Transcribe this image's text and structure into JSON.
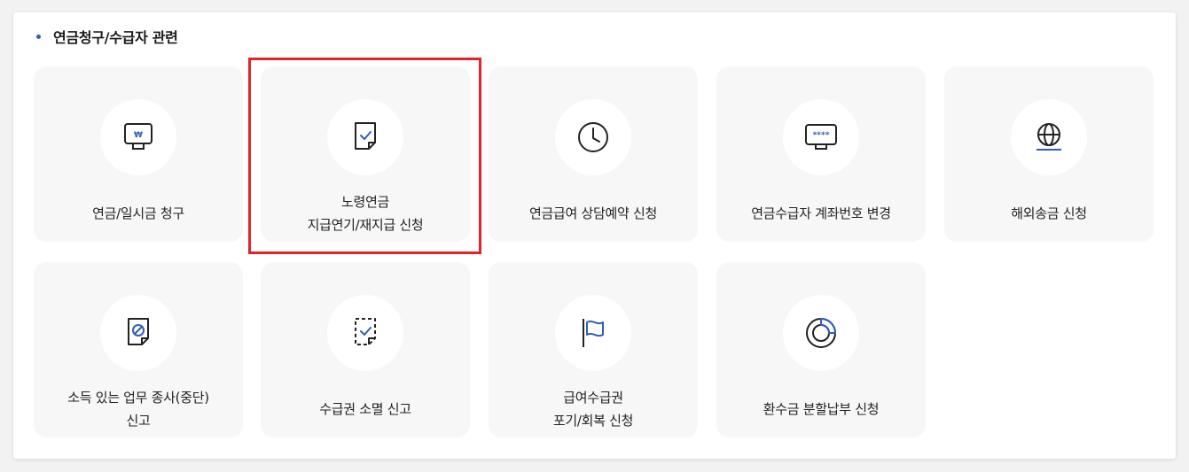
{
  "section": {
    "title": "연금청구/수급자 관련"
  },
  "colors": {
    "accent": "#2f5fb3",
    "highlight": "#e2232b",
    "card_bg": "#f7f7f7"
  },
  "cards": [
    {
      "icon": "monitor-won-icon",
      "lines": [
        "연금/일시금 청구"
      ]
    },
    {
      "icon": "document-check-icon",
      "lines": [
        "노령연금",
        "지급연기/재지급 신청"
      ],
      "highlighted": true
    },
    {
      "icon": "clock-icon",
      "lines": [
        "연금급여 상담예약 신청"
      ]
    },
    {
      "icon": "monitor-password-icon",
      "lines": [
        "연금수급자 계좌번호 변경"
      ]
    },
    {
      "icon": "globe-icon",
      "lines": [
        "해외송금 신청"
      ]
    },
    {
      "icon": "document-prohibited-icon",
      "lines": [
        "소득 있는 업무 종사(중단)",
        "신고"
      ]
    },
    {
      "icon": "dashed-document-check-icon",
      "lines": [
        "수급권 소멸 신고"
      ]
    },
    {
      "icon": "flag-icon",
      "lines": [
        "급여수급권",
        "포기/회복 신청"
      ]
    },
    {
      "icon": "ring-chart-icon",
      "lines": [
        "환수금 분할납부 신청"
      ]
    }
  ]
}
